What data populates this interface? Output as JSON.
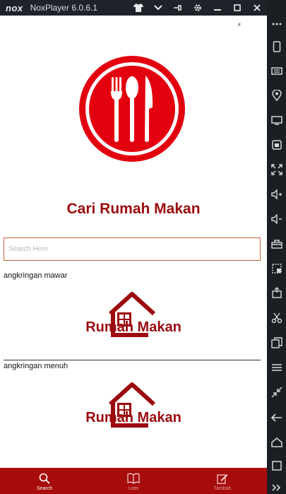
{
  "window": {
    "logo_text": "nox",
    "title": "NoxPlayer 6.0.6.1"
  },
  "status": {
    "flash_glyph": "⚡"
  },
  "app": {
    "title": "Cari Rumah Makan",
    "search_placeholder": "Search Here",
    "restaurants": [
      {
        "name": "angkringan mawar",
        "brand": "Rumah Makan"
      },
      {
        "name": "angkringan menuh",
        "brand": "Rumah Makan"
      }
    ]
  },
  "bottom_nav": [
    {
      "label": "Search",
      "icon": "search-icon"
    },
    {
      "label": "Lists",
      "icon": "book-icon"
    },
    {
      "label": "Tambah",
      "icon": "edit-icon"
    }
  ],
  "colors": {
    "brand_red": "#9b0a0e",
    "nav_red": "#a70b0b",
    "logo_red": "#e3000f"
  }
}
